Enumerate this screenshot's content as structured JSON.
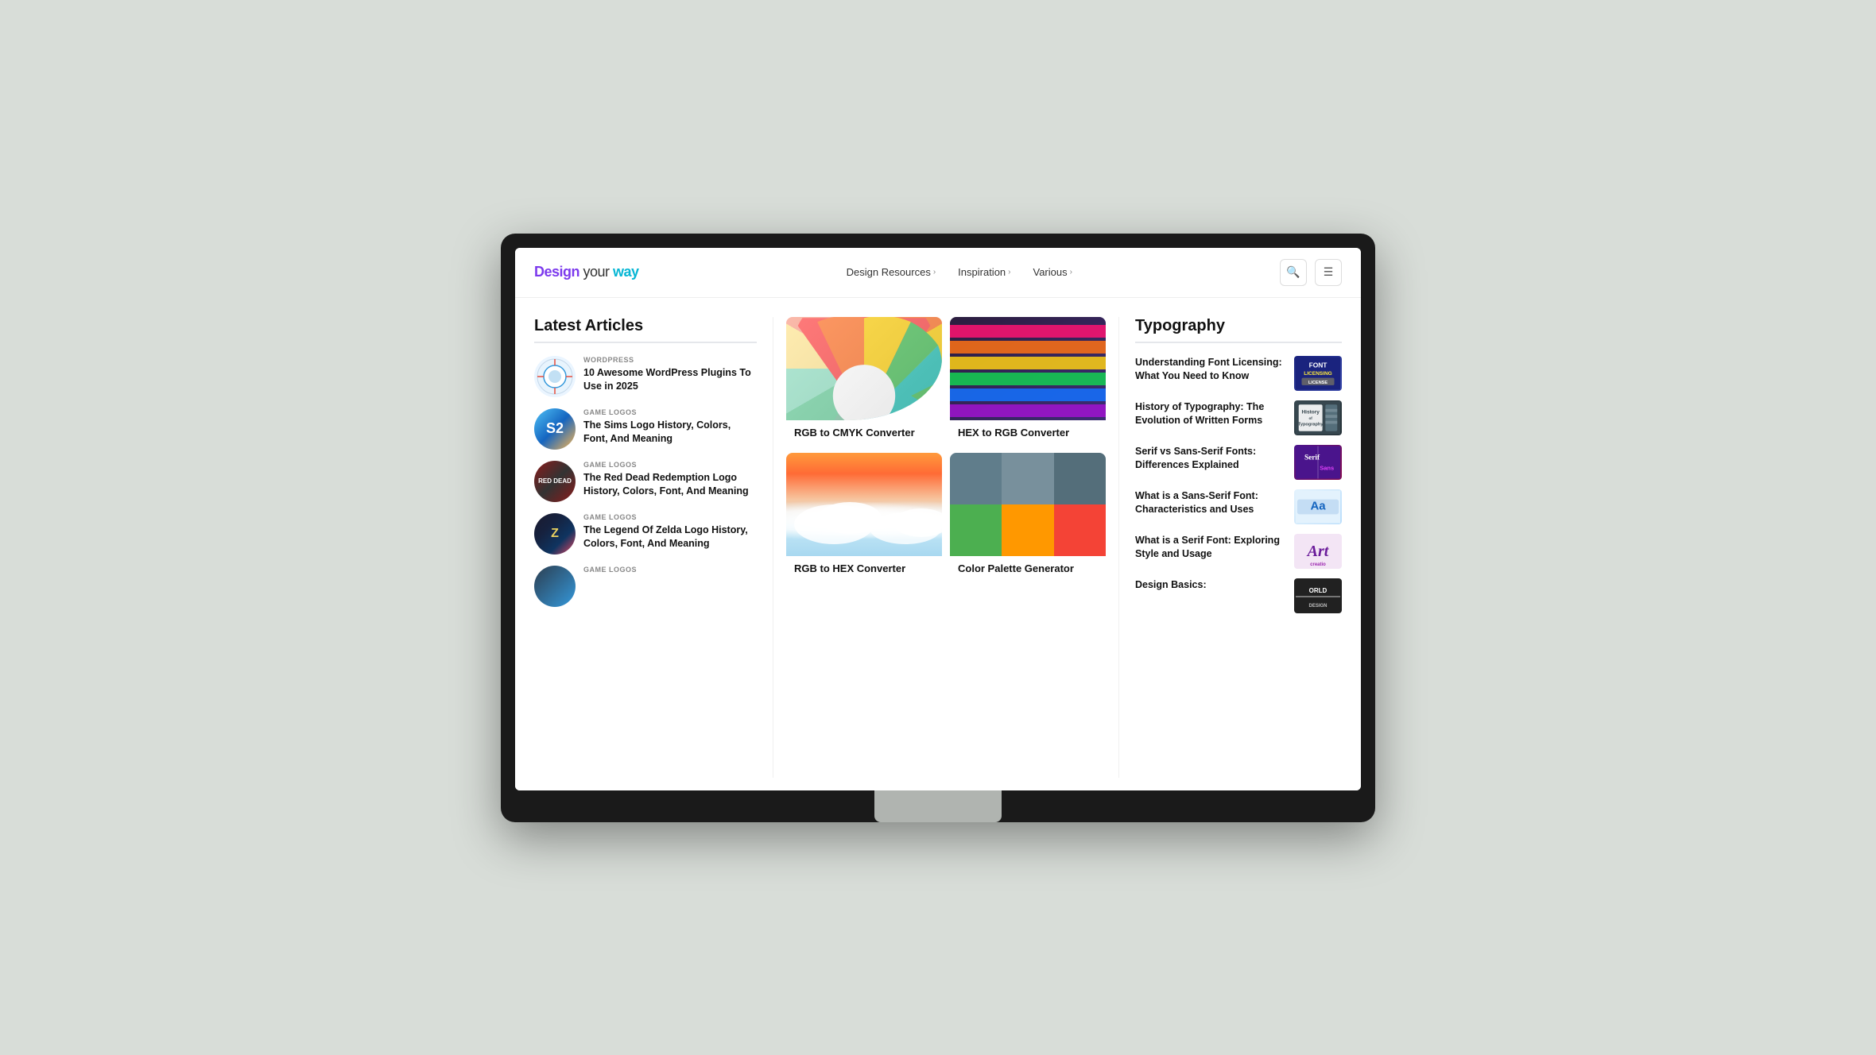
{
  "browser": {
    "title": "Design your way"
  },
  "nav": {
    "logo": {
      "design": "Design",
      "your": " your ",
      "way": "way"
    },
    "links": [
      {
        "label": "Design Resources",
        "has_chevron": true
      },
      {
        "label": "Inspiration",
        "has_chevron": true
      },
      {
        "label": "Various",
        "has_chevron": true
      }
    ]
  },
  "latest_articles": {
    "title": "Latest Articles",
    "items": [
      {
        "category": "WORDPRESS",
        "title": "10 Awesome WordPress Plugins To Use in 2025",
        "thumb_type": "wp"
      },
      {
        "category": "GAME LOGOS",
        "title": "The Sims Logo History, Colors, Font, And Meaning",
        "thumb_type": "sims"
      },
      {
        "category": "GAME LOGOS",
        "title": "The Red Dead Redemption Logo History, Colors, Font, And Meaning",
        "thumb_type": "rdr"
      },
      {
        "category": "GAME LOGOS",
        "title": "The Legend Of Zelda Logo History, Colors, Font, And Meaning",
        "thumb_type": "zelda"
      },
      {
        "category": "GAME LOGOS",
        "title": "",
        "thumb_type": "bottom"
      }
    ]
  },
  "tools": {
    "items": [
      {
        "label": "RGB to CMYK Converter",
        "img_type": "colorwheel"
      },
      {
        "label": "HEX to RGB Converter",
        "img_type": "rainbow"
      },
      {
        "label": "RGB to HEX Converter",
        "img_type": "sunset"
      },
      {
        "label": "Color Palette Generator",
        "img_type": "palette"
      }
    ]
  },
  "typography": {
    "title": "Typography",
    "items": [
      {
        "title": "Understanding Font Licensing: What You Need to Know",
        "thumb_type": "font-licensing"
      },
      {
        "title": "History of Typography: The Evolution of Written Forms",
        "thumb_type": "history-typo"
      },
      {
        "title": "Serif vs Sans-Serif Fonts: Differences Explained",
        "thumb_type": "serif-sans"
      },
      {
        "title": "What is a Sans-Serif Font: Characteristics and Uses",
        "thumb_type": "sans-serif"
      },
      {
        "title": "What is a Serif Font: Exploring Style and Usage",
        "thumb_type": "serif-font"
      },
      {
        "title": "Design Basics:",
        "thumb_type": "design-basics"
      }
    ]
  },
  "palette_colors": [
    "#607d8b",
    "#78909c",
    "#546e7a",
    "#4caf50",
    "#ff9800",
    "#f44336",
    "#9e9e9e",
    "#795548",
    "#e91e63"
  ]
}
